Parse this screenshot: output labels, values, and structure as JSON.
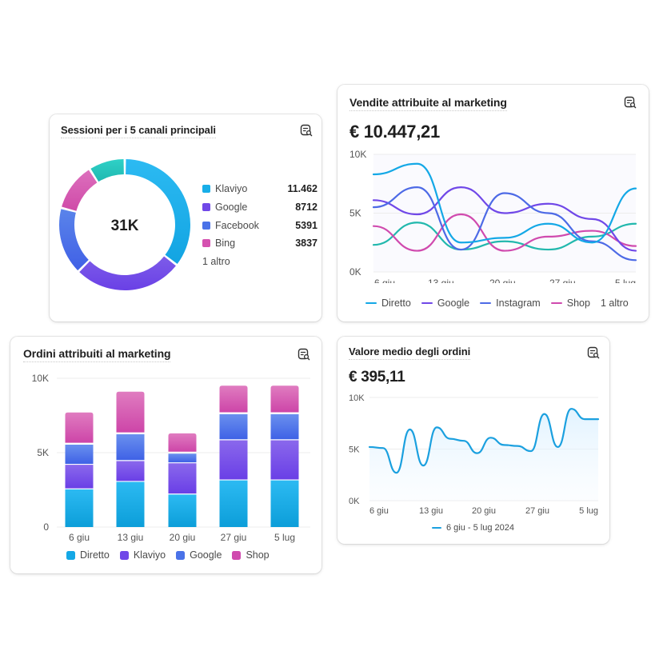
{
  "colors": {
    "diretto": "#14a8e6",
    "klaviyo": "#18aee8",
    "google": "#7048e8",
    "facebook": "#4a72e8",
    "instagram": "#4d6ae6",
    "bing": "#d552b0",
    "shop": "#d04aae",
    "other": "#22b8ad",
    "aov": "#1ba0df"
  },
  "icons": {
    "card_action": "report-search-icon"
  },
  "cards": {
    "sessions": {
      "title": "Sessioni per i 5 canali principali",
      "total_label": "31K",
      "legend": [
        {
          "name": "Klaviyo",
          "value": "11.462"
        },
        {
          "name": "Google",
          "value": "8712"
        },
        {
          "name": "Facebook",
          "value": "5391"
        },
        {
          "name": "Bing",
          "value": "3837"
        }
      ],
      "more_label": "1 altro"
    },
    "sales": {
      "title": "Vendite attribuite al marketing",
      "value": "€ 10.447,21",
      "legend": [
        "Diretto",
        "Google",
        "Instagram",
        "Shop"
      ],
      "more_label": "1 altro"
    },
    "orders": {
      "title": "Ordini attribuiti al marketing",
      "legend": [
        "Diretto",
        "Klaviyo",
        "Google",
        "Shop"
      ]
    },
    "aov": {
      "title": "Valore medio degli ordini",
      "value": "€ 395,11",
      "legend": "6 giu - 5 lug 2024"
    }
  },
  "chart_data": [
    {
      "id": "sessions",
      "type": "pie",
      "title": "Sessioni per i 5 canali principali",
      "center_label": "31K",
      "categories": [
        "Klaviyo",
        "Google",
        "Facebook",
        "Bing",
        "Altro"
      ],
      "values": [
        11462,
        8712,
        5391,
        3837,
        2900
      ],
      "donut": true
    },
    {
      "id": "sales",
      "type": "line",
      "title": "Vendite attribuite al marketing",
      "x_ticks": [
        "6 giu",
        "13 giu",
        "20 giu",
        "27 giu",
        "5 lug"
      ],
      "y_ticks": [
        "0K",
        "5K",
        "10K"
      ],
      "ylim": [
        0,
        10000
      ],
      "x_points": 7,
      "series": [
        {
          "name": "Diretto",
          "values": [
            8300,
            9200,
            2500,
            2900,
            4100,
            2500,
            7100
          ]
        },
        {
          "name": "Google",
          "values": [
            6100,
            4900,
            7200,
            5000,
            5800,
            4500,
            1800
          ]
        },
        {
          "name": "Instagram",
          "values": [
            5500,
            7200,
            1900,
            6700,
            5000,
            2600,
            1000
          ]
        },
        {
          "name": "Shop",
          "values": [
            3900,
            1800,
            4900,
            1800,
            3000,
            3500,
            2200
          ]
        },
        {
          "name": "Altro",
          "values": [
            2300,
            4200,
            1900,
            2600,
            1900,
            3000,
            4100
          ]
        }
      ],
      "grid": true,
      "legend": "bottom"
    },
    {
      "id": "orders",
      "type": "bar",
      "stacked": true,
      "title": "Ordini attribuiti al marketing",
      "categories": [
        "6 giu",
        "13 giu",
        "20 giu",
        "27 giu",
        "5 lug"
      ],
      "y_ticks": [
        "0",
        "5K",
        "10K"
      ],
      "ylim": [
        0,
        10000
      ],
      "series": [
        {
          "name": "Diretto",
          "values": [
            2600,
            3100,
            2250,
            3200,
            3200
          ]
        },
        {
          "name": "Klaviyo",
          "values": [
            1650,
            1400,
            2100,
            2700,
            2700
          ]
        },
        {
          "name": "Google",
          "values": [
            1350,
            1800,
            650,
            1750,
            1750
          ]
        },
        {
          "name": "Shop",
          "values": [
            2100,
            2800,
            1300,
            1850,
            1850
          ]
        }
      ],
      "grid": true,
      "legend": "bottom"
    },
    {
      "id": "aov",
      "type": "area",
      "title": "Valore medio degli ordini",
      "x_ticks": [
        "6 giu",
        "13 giu",
        "20 giu",
        "27 giu",
        "5 lug"
      ],
      "y_ticks": [
        "0K",
        "5K",
        "10K"
      ],
      "ylim": [
        0,
        10000
      ],
      "series": [
        {
          "name": "6 giu - 5 lug 2024",
          "values": [
            5200,
            5100,
            2700,
            6900,
            3400,
            7100,
            6000,
            5800,
            4600,
            6100,
            5400,
            5300,
            4800,
            8400,
            5200,
            8900,
            7900,
            7900
          ]
        }
      ],
      "grid": true,
      "legend": "bottom"
    }
  ]
}
